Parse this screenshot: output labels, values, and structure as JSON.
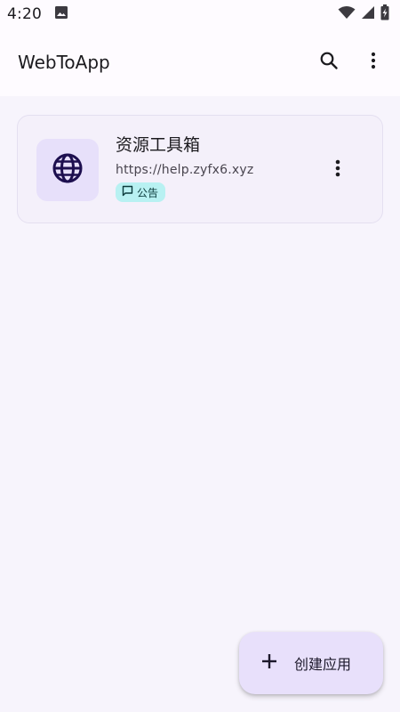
{
  "status_bar": {
    "time": "4:20",
    "icons": [
      "image-icon",
      "wifi-icon",
      "signal-icon",
      "battery-charging-icon"
    ]
  },
  "app_bar": {
    "title": "WebToApp",
    "actions": [
      "search-icon",
      "more-vert-icon"
    ]
  },
  "apps": [
    {
      "name": "资源工具箱",
      "url": "https://help.zyfx6.xyz",
      "icon": "globe-icon",
      "tag": {
        "icon": "announcement-icon",
        "label": "公告"
      }
    }
  ],
  "fab": {
    "icon": "plus-icon",
    "label": "创建应用"
  },
  "colors": {
    "background": "#f7f4fc",
    "surface": "#fefbff",
    "card": "#f4f0fa",
    "icon_box": "#e7e0fa",
    "tag_bg": "#b8f1f2",
    "fab_bg": "#e8e0fb",
    "accent_dark": "#1d0f4f"
  }
}
